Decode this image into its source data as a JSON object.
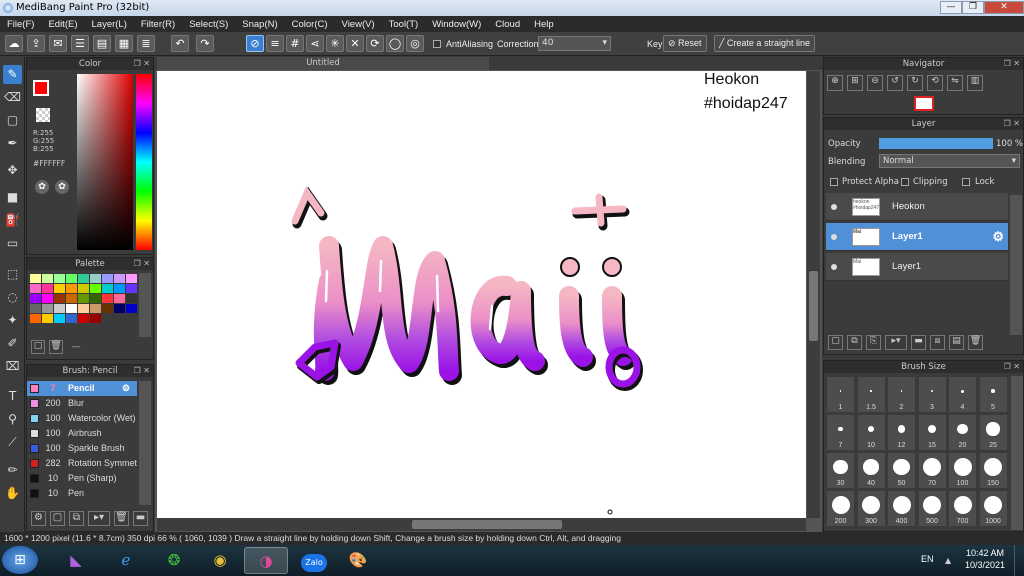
{
  "window": {
    "title": "MediBang Paint Pro (32bit)"
  },
  "menu": [
    "File(F)",
    "Edit(E)",
    "Layer(L)",
    "Filter(R)",
    "Select(S)",
    "Snap(N)",
    "Color(C)",
    "View(V)",
    "Tool(T)",
    "Window(W)",
    "Cloud",
    "Help"
  ],
  "toolbar": {
    "antialias_label": "AntiAliasing",
    "correction_label": "Correction",
    "correction_value": "40",
    "key_label": "Key",
    "reset_label": "Reset",
    "straight_label": "Create a straight line"
  },
  "color_panel": {
    "title": "Color",
    "r": "R:255",
    "g": "G:255",
    "b": "B:255",
    "hex": "#FFFFFF",
    "fg_color": "#ff0000"
  },
  "palette_panel": {
    "title": "Palette",
    "dash": "---",
    "swatches": [
      "#ffff99",
      "#ccff99",
      "#99ff99",
      "#66ff66",
      "#33cc99",
      "#99cccc",
      "#9999ff",
      "#cc99ff",
      "#ff99ff",
      "#ff66cc",
      "#ff3399",
      "#ffcc00",
      "#ff9900",
      "#cccc00",
      "#66ff00",
      "#00cccc",
      "#0099ff",
      "#6633ff",
      "#9900ff",
      "#ff00ff",
      "#993300",
      "#cc6600",
      "#669900",
      "#336600",
      "#ff3333",
      "#ff6699",
      "#333333",
      "#666666",
      "#999999",
      "#cccccc",
      "#ffffff",
      "#ffcc99",
      "#cc9966",
      "#663300",
      "#000066",
      "#0000cc",
      "#ff6600",
      "#ffcc00",
      "#00ccff",
      "#3366cc",
      "#cc0000",
      "#990000"
    ]
  },
  "brush_panel": {
    "title": "Brush: Pencil",
    "items": [
      {
        "color": "#ff7fbf",
        "size": "7",
        "name": "Pencil",
        "selected": true
      },
      {
        "color": "#f08fe0",
        "size": "200",
        "name": "Blur",
        "selected": false
      },
      {
        "color": "#7fd4f0",
        "size": "100",
        "name": "Watercolor (Wet)",
        "selected": false
      },
      {
        "color": "#dddddd",
        "size": "100",
        "name": "Airbrush",
        "selected": false
      },
      {
        "color": "#3b5be0",
        "size": "100",
        "name": "Sparkle Brush",
        "selected": false
      },
      {
        "color": "#d32020",
        "size": "282",
        "name": "Rotation Symmetry",
        "selected": false
      },
      {
        "color": "#111111",
        "size": "10",
        "name": "Pen (Sharp)",
        "selected": false
      },
      {
        "color": "#111111",
        "size": "10",
        "name": "Pen",
        "selected": false
      }
    ]
  },
  "canvas": {
    "tab_title": "Untitled",
    "watermark_line1": "Heokon",
    "watermark_line2": "#hoidap247"
  },
  "navigator": {
    "title": "Navigator"
  },
  "layer_panel": {
    "title": "Layer",
    "opacity_label": "Opacity",
    "opacity_value": "100 %",
    "opacity_fraction": 1.0,
    "blending_label": "Blending",
    "blending_value": "Normal",
    "protect_alpha": "Protect Alpha",
    "clipping": "Clipping",
    "lock": "Lock",
    "layers": [
      {
        "name": "Heokon",
        "thumb": "heokon #hoidap247",
        "selected": false
      },
      {
        "name": "Layer1",
        "thumb": "Mai",
        "selected": true
      },
      {
        "name": "Layer1",
        "thumb": "Mai",
        "selected": false
      }
    ]
  },
  "brush_size_panel": {
    "title": "Brush Size",
    "sizes": [
      "1",
      "1.5",
      "2",
      "3",
      "4",
      "5",
      "7",
      "10",
      "12",
      "15",
      "20",
      "25",
      "30",
      "40",
      "50",
      "70",
      "100",
      "150",
      "200",
      "300",
      "400",
      "500",
      "700",
      "1000"
    ]
  },
  "status": {
    "text": "1600 * 1200 pixel  (11.6 * 8.7cm)  350 dpi  66 %  ( 1060, 1039 )  Draw a straight line by holding down Shift, Change a brush size by holding down Ctrl, Alt, and dragging"
  },
  "taskbar": {
    "lang": "EN",
    "time": "10:42 AM",
    "date": "10/3/2021",
    "zalo": "Zalo"
  }
}
